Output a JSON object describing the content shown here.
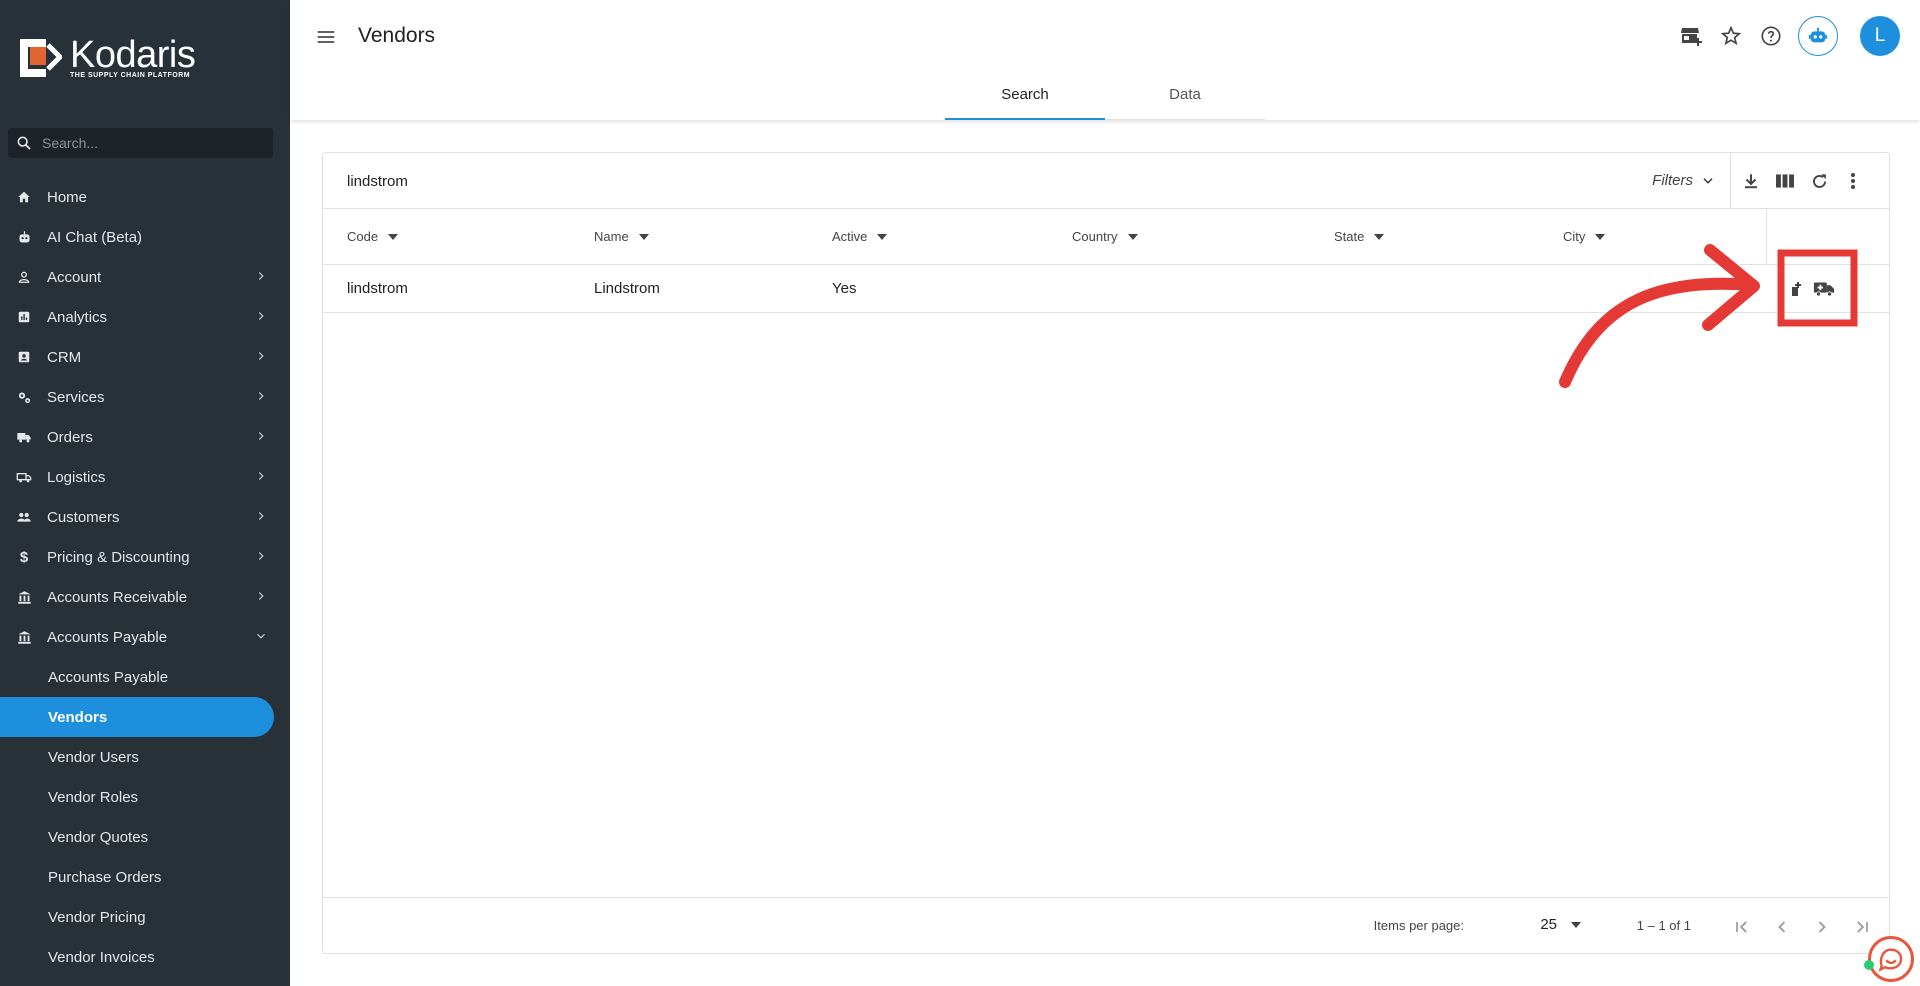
{
  "brand": {
    "name": "Kodaris",
    "tagline": "THE SUPPLY CHAIN PLATFORM"
  },
  "sidebar": {
    "search_placeholder": "Search...",
    "items": [
      {
        "label": "Home",
        "icon": "home-icon"
      },
      {
        "label": "AI Chat (Beta)",
        "icon": "robot-icon"
      },
      {
        "label": "Account",
        "icon": "person-icon"
      },
      {
        "label": "Analytics",
        "icon": "analytics-icon"
      },
      {
        "label": "CRM",
        "icon": "contact-card-icon"
      },
      {
        "label": "Services",
        "icon": "gears-icon"
      },
      {
        "label": "Orders",
        "icon": "truck-icon"
      },
      {
        "label": "Logistics",
        "icon": "delivery-icon"
      },
      {
        "label": "Customers",
        "icon": "people-icon"
      },
      {
        "label": "Pricing & Discounting",
        "icon": "dollar-icon"
      },
      {
        "label": "Accounts Receivable",
        "icon": "bank-icon"
      },
      {
        "label": "Accounts Payable",
        "icon": "bank-icon"
      }
    ],
    "sub_items": [
      {
        "label": "Accounts Payable"
      },
      {
        "label": "Vendors"
      },
      {
        "label": "Vendor Users"
      },
      {
        "label": "Vendor Roles"
      },
      {
        "label": "Vendor Quotes"
      },
      {
        "label": "Purchase Orders"
      },
      {
        "label": "Vendor Pricing"
      },
      {
        "label": "Vendor Invoices"
      }
    ]
  },
  "header": {
    "title": "Vendors",
    "avatar_initial": "L",
    "tabs": [
      {
        "label": "Search"
      },
      {
        "label": "Data"
      }
    ]
  },
  "search": {
    "value": "lindstrom",
    "filters_label": "Filters"
  },
  "table": {
    "columns": [
      "Code",
      "Name",
      "Active",
      "Country",
      "State",
      "City"
    ],
    "rows": [
      {
        "code": "lindstrom",
        "name": "Lindstrom",
        "active": "Yes",
        "country": "",
        "state": "",
        "city": ""
      }
    ]
  },
  "pagination": {
    "items_per_page_label": "Items per page:",
    "items_per_page": "25",
    "range": "1 – 1 of 1"
  },
  "colors": {
    "sidebar_bg": "#283038",
    "accent": "#1e8fdc",
    "annotation": "#e53935"
  }
}
